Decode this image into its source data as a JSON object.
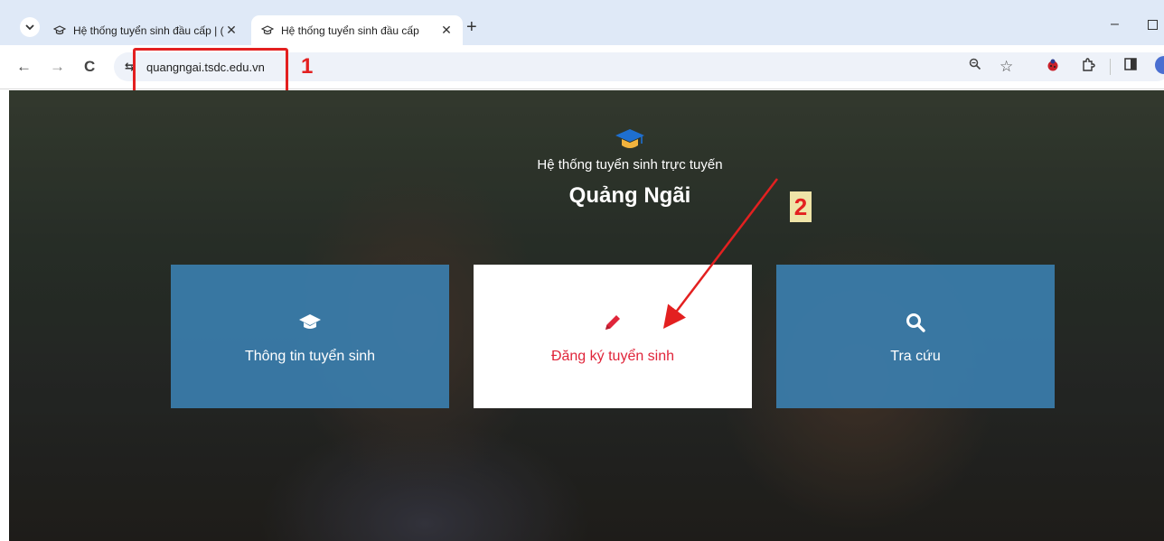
{
  "browser": {
    "tabs": [
      {
        "title": "Hệ thống tuyển sinh đầu cấp | (",
        "close": "✕",
        "active": false
      },
      {
        "title": "Hệ thống tuyển sinh đầu cấp",
        "close": "✕",
        "active": true
      }
    ],
    "new_tab": "+",
    "minimize": "–",
    "nav": {
      "back": "←",
      "forward": "→",
      "reload": "C"
    },
    "omnibox": {
      "site_info": "⇆",
      "url": "quangngai.tsdc.edu.vn",
      "zoom_icon": "zoom-icon",
      "bookmark_icon": "☆"
    }
  },
  "annotations": {
    "box_1_number": "1",
    "arrow_2_number": "2",
    "color": "#e32020"
  },
  "hero": {
    "subtitle": "Hệ thống tuyển sinh trực tuyến",
    "title": "Quảng Ngãi",
    "tiles": [
      {
        "label": "Thông tin tuyển sinh",
        "icon": "graduation-cap-icon",
        "style": "blue"
      },
      {
        "label": "Đăng ký tuyển sinh",
        "icon": "pencil-icon",
        "style": "white"
      },
      {
        "label": "Tra cứu",
        "icon": "search-icon",
        "style": "blue"
      }
    ]
  },
  "colors": {
    "tile_blue": "#3b82b4",
    "register_red": "#e0253a",
    "tab_strip": "#dfe9f7",
    "cap_blue": "#1e6fd0",
    "cap_gold": "#f2b33d"
  }
}
